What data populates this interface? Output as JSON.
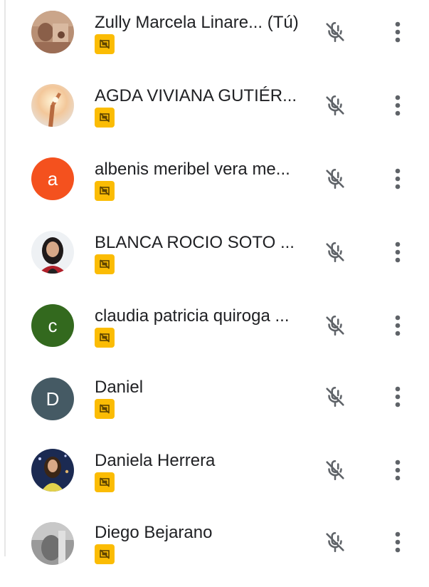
{
  "participants": [
    {
      "name": "Zully Marcela Linare... (Tú)",
      "avatar": {
        "type": "photo",
        "icon": "user-photo-avatar"
      },
      "badge_icon": "presentation-off-icon",
      "mic_icon": "mic-off-icon",
      "menu_icon": "more-vert-icon"
    },
    {
      "name": "AGDA VIVIANA GUTIÉR...",
      "avatar": {
        "type": "photo",
        "icon": "user-photo-avatar"
      },
      "badge_icon": "presentation-off-icon",
      "mic_icon": "mic-off-icon",
      "menu_icon": "more-vert-icon"
    },
    {
      "name": "albenis meribel vera me...",
      "avatar": {
        "type": "letter",
        "letter": "a",
        "color": "#f4511e"
      },
      "badge_icon": "presentation-off-icon",
      "mic_icon": "mic-off-icon",
      "menu_icon": "more-vert-icon"
    },
    {
      "name": "BLANCA ROCIO SOTO ...",
      "avatar": {
        "type": "photo",
        "icon": "user-photo-avatar"
      },
      "badge_icon": "presentation-off-icon",
      "mic_icon": "mic-off-icon",
      "menu_icon": "more-vert-icon"
    },
    {
      "name": "claudia patricia quiroga ...",
      "avatar": {
        "type": "letter",
        "letter": "c",
        "color": "#33691e"
      },
      "badge_icon": "presentation-off-icon",
      "mic_icon": "mic-off-icon",
      "menu_icon": "more-vert-icon"
    },
    {
      "name": "Daniel",
      "avatar": {
        "type": "letter",
        "letter": "D",
        "color": "#455a64"
      },
      "badge_icon": "presentation-off-icon",
      "mic_icon": "mic-off-icon",
      "menu_icon": "more-vert-icon"
    },
    {
      "name": "Daniela Herrera",
      "avatar": {
        "type": "photo",
        "icon": "user-photo-avatar"
      },
      "badge_icon": "presentation-off-icon",
      "mic_icon": "mic-off-icon",
      "menu_icon": "more-vert-icon"
    },
    {
      "name": "Diego Bejarano",
      "avatar": {
        "type": "photo",
        "icon": "user-photo-avatar"
      },
      "badge_icon": "presentation-off-icon",
      "mic_icon": "mic-off-icon",
      "menu_icon": "more-vert-icon"
    }
  ],
  "colors": {
    "badge_bg": "#fbbc04",
    "icon_gray": "#5f6368",
    "text": "#202124"
  }
}
